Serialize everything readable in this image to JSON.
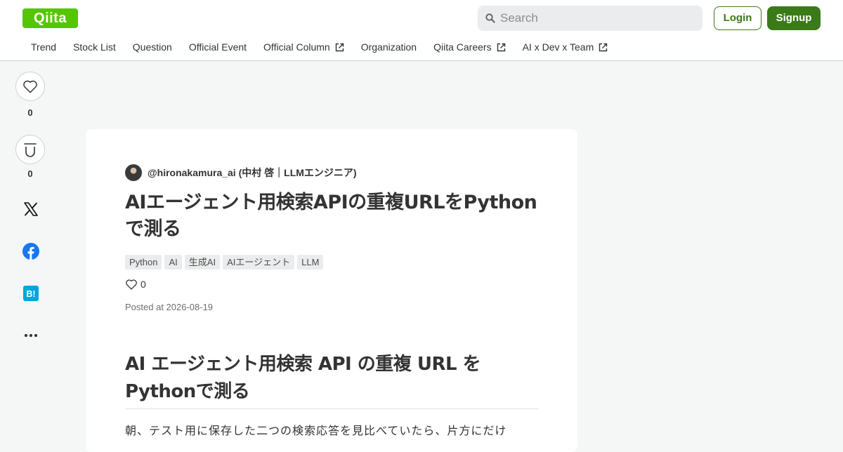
{
  "header": {
    "logo_text": "Qiita",
    "search_placeholder": "Search",
    "login_label": "Login",
    "signup_label": "Signup",
    "brand_color": "#55c500",
    "button_color": "#3a7a18"
  },
  "nav": {
    "items": [
      {
        "label": "Trend",
        "external": false
      },
      {
        "label": "Stock List",
        "external": false
      },
      {
        "label": "Question",
        "external": false
      },
      {
        "label": "Official Event",
        "external": false
      },
      {
        "label": "Official Column",
        "external": true
      },
      {
        "label": "Organization",
        "external": false
      },
      {
        "label": "Qiita Careers",
        "external": true
      },
      {
        "label": "AI x Dev x Team",
        "external": true
      }
    ]
  },
  "sidebar": {
    "like_count": "0",
    "stock_count": "0",
    "icons": [
      "heart-icon",
      "stock-icon",
      "x-share-icon",
      "facebook-share-icon",
      "hatena-bookmark-icon",
      "more-icon"
    ]
  },
  "article": {
    "author": "@hironakamura_ai (中村 啓｜LLMエンジニア)",
    "title": "AIエージェント用検索APIの重複URLをPythonで測る",
    "tags": [
      "Python",
      "AI",
      "生成AI",
      "AIエージェント",
      "LLM"
    ],
    "likes": "0",
    "posted": "Posted at 2026-08-19",
    "heading": "AI エージェント用検索 API の重複 URL を Pythonで測る",
    "first_line": "朝、テスト用に保存した二つの検索応答を見比べていたら、片方にだけ"
  }
}
